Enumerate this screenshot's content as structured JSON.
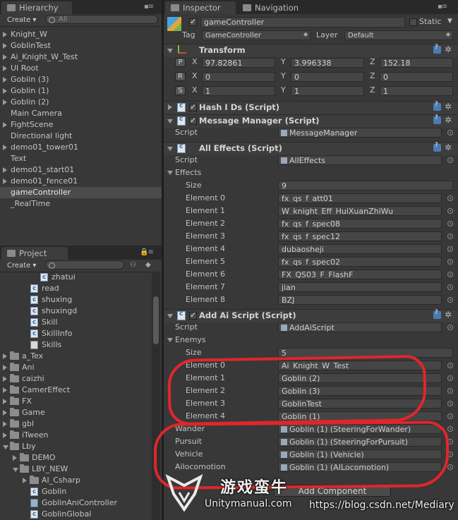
{
  "hierarchy": {
    "tab": "Hierarchy",
    "create": "Create",
    "search_placeholder": "All",
    "items": [
      {
        "label": "Knight_W",
        "expandable": true
      },
      {
        "label": "GoblinTest",
        "expandable": true
      },
      {
        "label": "Ai_Knight_W_Test",
        "expandable": true
      },
      {
        "label": "UI Root",
        "expandable": true
      },
      {
        "label": "Goblin (3)",
        "expandable": true
      },
      {
        "label": "Goblin (1)",
        "expandable": true
      },
      {
        "label": "Goblin (2)",
        "expandable": true
      },
      {
        "label": "Main Camera",
        "expandable": false
      },
      {
        "label": "FightScene",
        "expandable": true
      },
      {
        "label": "Directional light",
        "expandable": false
      },
      {
        "label": "demo01_tower01",
        "expandable": true
      },
      {
        "label": "Text",
        "expandable": false
      },
      {
        "label": "demo01_start01",
        "expandable": true
      },
      {
        "label": "demo01_fence01",
        "expandable": true
      },
      {
        "label": "gameController",
        "expandable": false,
        "selected": true
      },
      {
        "label": "_RealTime",
        "expandable": false
      }
    ]
  },
  "project": {
    "tab": "Project",
    "create": "Create",
    "items": [
      {
        "label": "zhatui",
        "icon": "cs",
        "indent": 3
      },
      {
        "label": "read",
        "icon": "cs",
        "indent": 2
      },
      {
        "label": "shuxing",
        "icon": "cs",
        "indent": 2
      },
      {
        "label": "shuxingd",
        "icon": "cs",
        "indent": 2
      },
      {
        "label": "Skill",
        "icon": "cs",
        "indent": 2
      },
      {
        "label": "SkillInfo",
        "icon": "cs",
        "indent": 2
      },
      {
        "label": "Skills",
        "icon": "table",
        "indent": 2
      },
      {
        "label": "a_Tex",
        "icon": "folder",
        "indent": 0,
        "tri": "closed"
      },
      {
        "label": "Ani",
        "icon": "folder",
        "indent": 0,
        "tri": "closed"
      },
      {
        "label": "caizhi",
        "icon": "folder",
        "indent": 0,
        "tri": "closed"
      },
      {
        "label": "CamerEffect",
        "icon": "folder",
        "indent": 0,
        "tri": "closed"
      },
      {
        "label": "FX",
        "icon": "folder",
        "indent": 0,
        "tri": "closed"
      },
      {
        "label": "Game",
        "icon": "folder",
        "indent": 0,
        "tri": "closed"
      },
      {
        "label": "gbl",
        "icon": "folder",
        "indent": 0,
        "tri": "closed"
      },
      {
        "label": "iTween",
        "icon": "folder",
        "indent": 0,
        "tri": "closed"
      },
      {
        "label": "Lby",
        "icon": "folder",
        "indent": 0,
        "tri": "open"
      },
      {
        "label": "DEMO",
        "icon": "folder",
        "indent": 1,
        "tri": "closed"
      },
      {
        "label": "LBY_NEW",
        "icon": "folder",
        "indent": 1,
        "tri": "open"
      },
      {
        "label": "AI_Csharp",
        "icon": "folder",
        "indent": 2,
        "tri": "closed"
      },
      {
        "label": "Goblin",
        "icon": "cs",
        "indent": 2
      },
      {
        "label": "GoblinAniController",
        "icon": "ctrl",
        "indent": 2
      },
      {
        "label": "GoblinGlobal",
        "icon": "cs",
        "indent": 2
      }
    ]
  },
  "inspector": {
    "tab": "Inspector",
    "tab2": "Navigation",
    "object_name": "gameController",
    "static_label": "Static",
    "tag_label": "Tag",
    "tag_value": "GameController",
    "layer_label": "Layer",
    "layer_value": "Default",
    "transform": {
      "title": "Transform",
      "rows": [
        {
          "btn": "P",
          "x": "97.82861",
          "y": "3.996338",
          "z": "152.18"
        },
        {
          "btn": "R",
          "x": "0",
          "y": "0",
          "z": "0"
        },
        {
          "btn": "S",
          "x": "1",
          "y": "1",
          "z": "1"
        }
      ],
      "xl": "X",
      "yl": "Y",
      "zl": "Z"
    },
    "hash": {
      "title": "Hash I Ds (Script)"
    },
    "message": {
      "title": "Message Manager (Script)",
      "script_label": "Script",
      "script_value": "MessageManager"
    },
    "effects": {
      "title": "All Effects (Script)",
      "script_label": "Script",
      "script_value": "AllEffects",
      "list_label": "Effects",
      "size_label": "Size",
      "size_value": "9",
      "elements": [
        {
          "label": "Element 0",
          "value": "fx_qs_f_att01"
        },
        {
          "label": "Element 1",
          "value": "W_knight_Eff_HuiXuanZhiWu"
        },
        {
          "label": "Element 2",
          "value": "fx_qs_f_spec08"
        },
        {
          "label": "Element 3",
          "value": "fx_qs_f_spec12"
        },
        {
          "label": "Element 4",
          "value": "dubaosheji"
        },
        {
          "label": "Element 5",
          "value": "fx_qs_f_spec02"
        },
        {
          "label": "Element 6",
          "value": "FX_QS03_F_FlashF"
        },
        {
          "label": "Element 7",
          "value": "jian"
        },
        {
          "label": "Element 8",
          "value": "BZJ"
        }
      ]
    },
    "ai": {
      "title": "Add Ai Script (Script)",
      "script_label": "Script",
      "script_value": "AddAiScript",
      "list_label": "Enemys",
      "size_label": "Size",
      "size_value": "5",
      "elements": [
        {
          "label": "Element 0",
          "value": "Ai_Knight_W_Test"
        },
        {
          "label": "Element 1",
          "value": "Goblin (2)"
        },
        {
          "label": "Element 2",
          "value": "Goblin (3)"
        },
        {
          "label": "Element 3",
          "value": "GoblinTest"
        },
        {
          "label": "Element 4",
          "value": "Goblin (1)"
        }
      ],
      "refs": [
        {
          "label": "Wander",
          "value": "Goblin (1) (SteeringForWander)"
        },
        {
          "label": "Pursuit",
          "value": "Goblin (1) (SteeringForPursuit)"
        },
        {
          "label": "Vehicle",
          "value": "Goblin (1) (Vehicle)"
        },
        {
          "label": "Ailocomotion",
          "value": "Goblin (1) (AILocomotion)"
        }
      ]
    },
    "add_component": "Add Component"
  },
  "watermark": {
    "cn": "游戏蛮牛",
    "site": "Unitymanual.com",
    "url": "https://blog.csdn.net/Mediary"
  },
  "colors": {
    "annotation": "#e0262b",
    "selection": "#4b4b4b"
  }
}
